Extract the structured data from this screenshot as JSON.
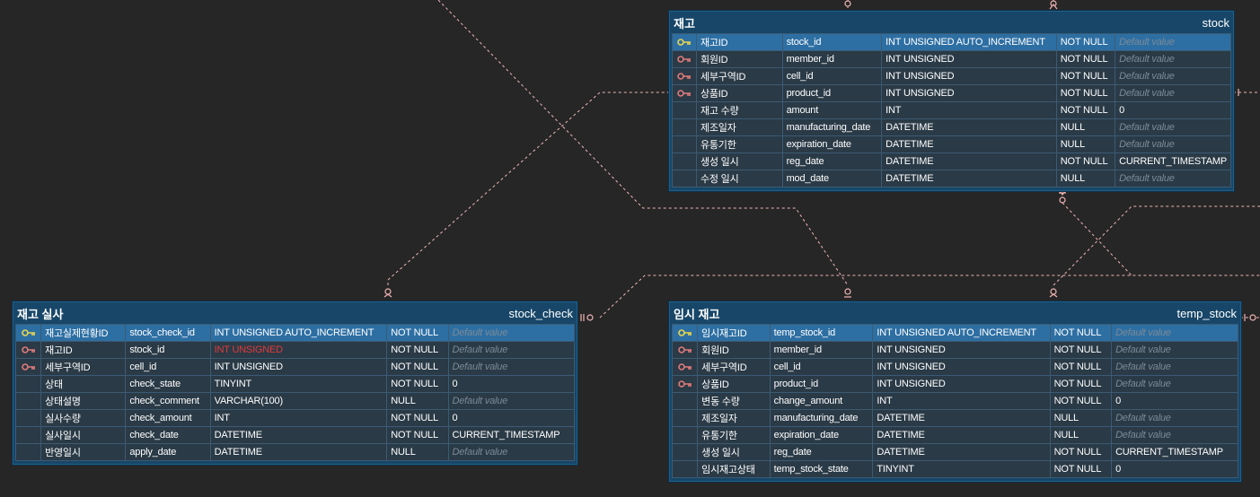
{
  "colors": {
    "background": "#262626",
    "table_header": "#174668",
    "pk_row": "#2e6fa3",
    "row": "#2a3a46",
    "relation_line": "#f2b5b5",
    "pk_key_icon": "#e8d44d",
    "fk_key_icon": "#e07a7a",
    "placeholder_text": "#7b8a96",
    "error_text": "#e03a3a"
  },
  "tables": [
    {
      "id": "stock",
      "logical_name": "재고",
      "physical_name": "stock",
      "columns": [
        {
          "key": "pk",
          "logical": "재고ID",
          "physical": "stock_id",
          "type": "INT UNSIGNED AUTO_INCREMENT",
          "nullable": "NOT NULL",
          "default": "Default value",
          "default_placeholder": true
        },
        {
          "key": "fk",
          "logical": "회원ID",
          "physical": "member_id",
          "type": "INT UNSIGNED",
          "nullable": "NOT NULL",
          "default": "Default value",
          "default_placeholder": true
        },
        {
          "key": "fk",
          "logical": "세부구역ID",
          "physical": "cell_id",
          "type": "INT UNSIGNED",
          "nullable": "NOT NULL",
          "default": "Default value",
          "default_placeholder": true
        },
        {
          "key": "fk",
          "logical": "상품ID",
          "physical": "product_id",
          "type": "INT UNSIGNED",
          "nullable": "NOT NULL",
          "default": "Default value",
          "default_placeholder": true
        },
        {
          "key": "",
          "logical": "재고 수량",
          "physical": "amount",
          "type": "INT",
          "nullable": "NOT NULL",
          "default": "0",
          "default_placeholder": false
        },
        {
          "key": "",
          "logical": "제조일자",
          "physical": "manufacturing_date",
          "type": "DATETIME",
          "nullable": "NULL",
          "default": "Default value",
          "default_placeholder": true
        },
        {
          "key": "",
          "logical": "유통기한",
          "physical": "expiration_date",
          "type": "DATETIME",
          "nullable": "NULL",
          "default": "Default value",
          "default_placeholder": true
        },
        {
          "key": "",
          "logical": "생성 일시",
          "physical": "reg_date",
          "type": "DATETIME",
          "nullable": "NOT NULL",
          "default": "CURRENT_TIMESTAMP",
          "default_placeholder": false
        },
        {
          "key": "",
          "logical": "수정 일시",
          "physical": "mod_date",
          "type": "DATETIME",
          "nullable": "NULL",
          "default": "Default value",
          "default_placeholder": true
        }
      ]
    },
    {
      "id": "stock_check",
      "logical_name": "재고 실사",
      "physical_name": "stock_check",
      "columns": [
        {
          "key": "pk",
          "logical": "재고실제현황ID",
          "physical": "stock_check_id",
          "type": "INT UNSIGNED AUTO_INCREMENT",
          "nullable": "NOT NULL",
          "default": "Default value",
          "default_placeholder": true
        },
        {
          "key": "fk",
          "logical": "재고ID",
          "physical": "stock_id",
          "type": "INT UNSIGNED",
          "type_error": true,
          "nullable": "NOT NULL",
          "default": "Default value",
          "default_placeholder": true
        },
        {
          "key": "fk",
          "logical": "세부구역ID",
          "physical": "cell_id",
          "type": "INT UNSIGNED",
          "nullable": "NOT NULL",
          "default": "Default value",
          "default_placeholder": true
        },
        {
          "key": "",
          "logical": "상태",
          "physical": "check_state",
          "type": "TINYINT",
          "nullable": "NOT NULL",
          "default": "0",
          "default_placeholder": false
        },
        {
          "key": "",
          "logical": "상태설명",
          "physical": "check_comment",
          "type": "VARCHAR(100)",
          "nullable": "NULL",
          "default": "Default value",
          "default_placeholder": true
        },
        {
          "key": "",
          "logical": "실사수량",
          "physical": "check_amount",
          "type": "INT",
          "nullable": "NOT NULL",
          "default": "0",
          "default_placeholder": false
        },
        {
          "key": "",
          "logical": "실사일시",
          "physical": "check_date",
          "type": "DATETIME",
          "nullable": "NOT NULL",
          "default": "CURRENT_TIMESTAMP",
          "default_placeholder": false
        },
        {
          "key": "",
          "logical": "반영일시",
          "physical": "apply_date",
          "type": "DATETIME",
          "nullable": "NULL",
          "default": "Default value",
          "default_placeholder": true
        }
      ]
    },
    {
      "id": "temp_stock",
      "logical_name": "임시 재고",
      "physical_name": "temp_stock",
      "columns": [
        {
          "key": "pk",
          "logical": "임시재고ID",
          "physical": "temp_stock_id",
          "type": "INT UNSIGNED AUTO_INCREMENT",
          "nullable": "NOT NULL",
          "default": "Default value",
          "default_placeholder": true
        },
        {
          "key": "fk",
          "logical": "회원ID",
          "physical": "member_id",
          "type": "INT UNSIGNED",
          "nullable": "NOT NULL",
          "default": "Default value",
          "default_placeholder": true
        },
        {
          "key": "fk",
          "logical": "세부구역ID",
          "physical": "cell_id",
          "type": "INT UNSIGNED",
          "nullable": "NOT NULL",
          "default": "Default value",
          "default_placeholder": true
        },
        {
          "key": "fk",
          "logical": "상품ID",
          "physical": "product_id",
          "type": "INT UNSIGNED",
          "nullable": "NOT NULL",
          "default": "Default value",
          "default_placeholder": true
        },
        {
          "key": "",
          "logical": "변동 수량",
          "physical": "change_amount",
          "type": "INT",
          "nullable": "NOT NULL",
          "default": "0",
          "default_placeholder": false
        },
        {
          "key": "",
          "logical": "제조일자",
          "physical": "manufacturing_date",
          "type": "DATETIME",
          "nullable": "NULL",
          "default": "Default value",
          "default_placeholder": true
        },
        {
          "key": "",
          "logical": "유통기한",
          "physical": "expiration_date",
          "type": "DATETIME",
          "nullable": "NULL",
          "default": "Default value",
          "default_placeholder": true
        },
        {
          "key": "",
          "logical": "생성 일시",
          "physical": "reg_date",
          "type": "DATETIME",
          "nullable": "NOT NULL",
          "default": "CURRENT_TIMESTAMP",
          "default_placeholder": false
        },
        {
          "key": "",
          "logical": "임시재고상태",
          "physical": "temp_stock_state",
          "type": "TINYINT",
          "nullable": "NOT NULL",
          "default": "0",
          "default_placeholder": false
        }
      ]
    }
  ]
}
